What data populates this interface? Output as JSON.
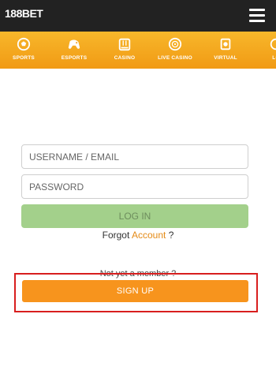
{
  "header": {
    "logo_text": "188BET",
    "menu_icon": "hamburger-menu-icon"
  },
  "nav": {
    "items": [
      {
        "label": "SPORTS",
        "icon": "soccer-ball-icon"
      },
      {
        "label": "ESPORTS",
        "icon": "game-controller-icon"
      },
      {
        "label": "CASINO",
        "icon": "slot-machine-icon"
      },
      {
        "label": "LIVE CASINO",
        "icon": "roulette-icon"
      },
      {
        "label": "VIRTUAL",
        "icon": "virtual-screen-icon"
      },
      {
        "label": "LO",
        "icon": "lottery-icon"
      }
    ]
  },
  "login": {
    "username_placeholder": "USERNAME / EMAIL",
    "password_placeholder": "PASSWORD",
    "login_label": "LOG IN",
    "forgot_prefix": "Forgot",
    "forgot_link": "Account",
    "forgot_suffix": "?"
  },
  "signup": {
    "member_text": "Not yet a member ?",
    "signup_label": "SIGN UP"
  },
  "colors": {
    "topbar": "#222222",
    "nav_orange": "#f5a623",
    "login_green": "#a3d08b",
    "signup_orange": "#f7941d",
    "highlight_red": "#d81e1e"
  }
}
